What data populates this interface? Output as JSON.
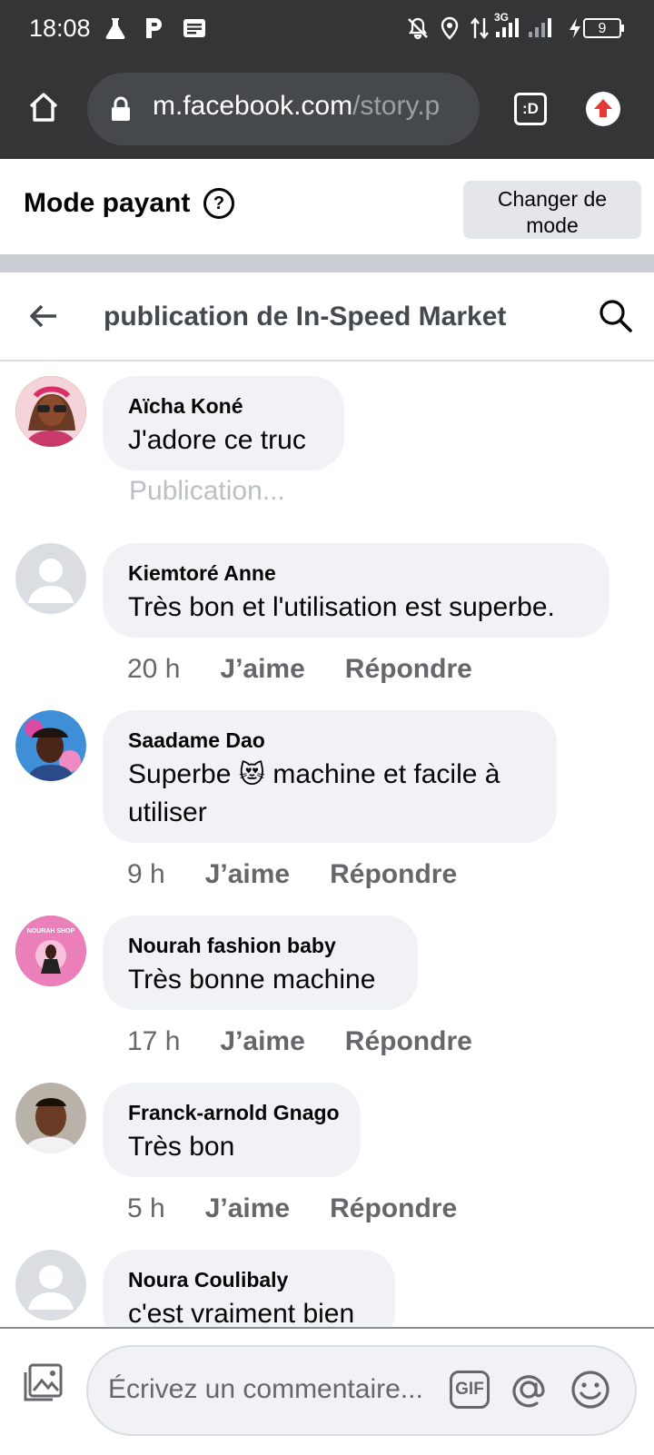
{
  "status_bar": {
    "time": "18:08",
    "network": "3G",
    "battery": "9",
    "icons": [
      "flask-icon",
      "parking-icon",
      "news-icon",
      "bell-off-icon",
      "location-icon",
      "data-transfer-icon",
      "signal-icon",
      "charging-icon",
      "battery-icon"
    ]
  },
  "browser": {
    "url_host": "m.facebook.com",
    "url_path": "/story.p",
    "tabs_badge": ":D"
  },
  "mode_banner": {
    "label": "Mode payant",
    "help": "?",
    "button_line1": "Changer de",
    "button_line2": "mode"
  },
  "header": {
    "title": "publication de In-Speed Market"
  },
  "comments": [
    {
      "name": "Aïcha Koné",
      "text": "J'adore ce truc",
      "status": "Publication..."
    },
    {
      "name": "Kiemtoré Anne",
      "text": "Très bon et l'utilisation est superbe.",
      "time": "20 h"
    },
    {
      "name": "Saadame Dao",
      "text_before": "Superbe",
      "emoji": "😻",
      "text_after": "machine et facile à utiliser",
      "time": "9 h"
    },
    {
      "name": "Nourah fashion baby",
      "text": "Très bonne machine",
      "time": "17 h",
      "avatar_text": "NOURAH SHOP"
    },
    {
      "name": "Franck-arnold Gnago",
      "text": "Très bon",
      "time": "5 h"
    },
    {
      "name": "Noura Coulibaly",
      "text": "c'est vraiment bien"
    }
  ],
  "actions": {
    "like": "J’aime",
    "reply": "Répondre"
  },
  "composer": {
    "placeholder": "Écrivez un commentaire...",
    "gif_label": "GIF"
  }
}
